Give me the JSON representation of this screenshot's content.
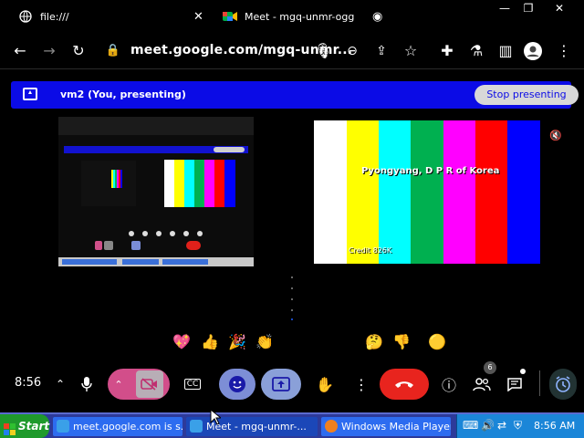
{
  "browser": {
    "tabs": [
      {
        "title": "file:///",
        "icon": "globe-icon",
        "active": false
      },
      {
        "title": "Meet - mgq-unmr-ogg",
        "icon": "meet-icon",
        "active": true
      }
    ],
    "url": "meet.google.com/mgq-unmr...",
    "window_controls": [
      "minimize",
      "restore",
      "close"
    ]
  },
  "meet": {
    "banner": {
      "title": "vm2 (You, presenting)",
      "stop_label": "Stop presenting"
    },
    "remote_video": {
      "caption": "Pyongyang, D P R of Korea",
      "watermark": "Credit 826K",
      "bar_colors": [
        "#ffffff",
        "#ffff00",
        "#00ffff",
        "#00b050",
        "#ff00ff",
        "#ff0000",
        "#0000ff"
      ]
    },
    "reactions": [
      "💖",
      "👍",
      "🎉",
      "👏",
      "😂",
      "😮",
      "😢",
      "🤔",
      "👎",
      "🟡"
    ],
    "clock": "8:56",
    "people_count": "6"
  },
  "taskbar": {
    "start_label": "Start",
    "items": [
      {
        "label": "meet.google.com is s..."
      },
      {
        "label": "Meet - mgq-unmr-..."
      },
      {
        "label": "Windows Media Player"
      }
    ],
    "time": "8:56 AM"
  }
}
